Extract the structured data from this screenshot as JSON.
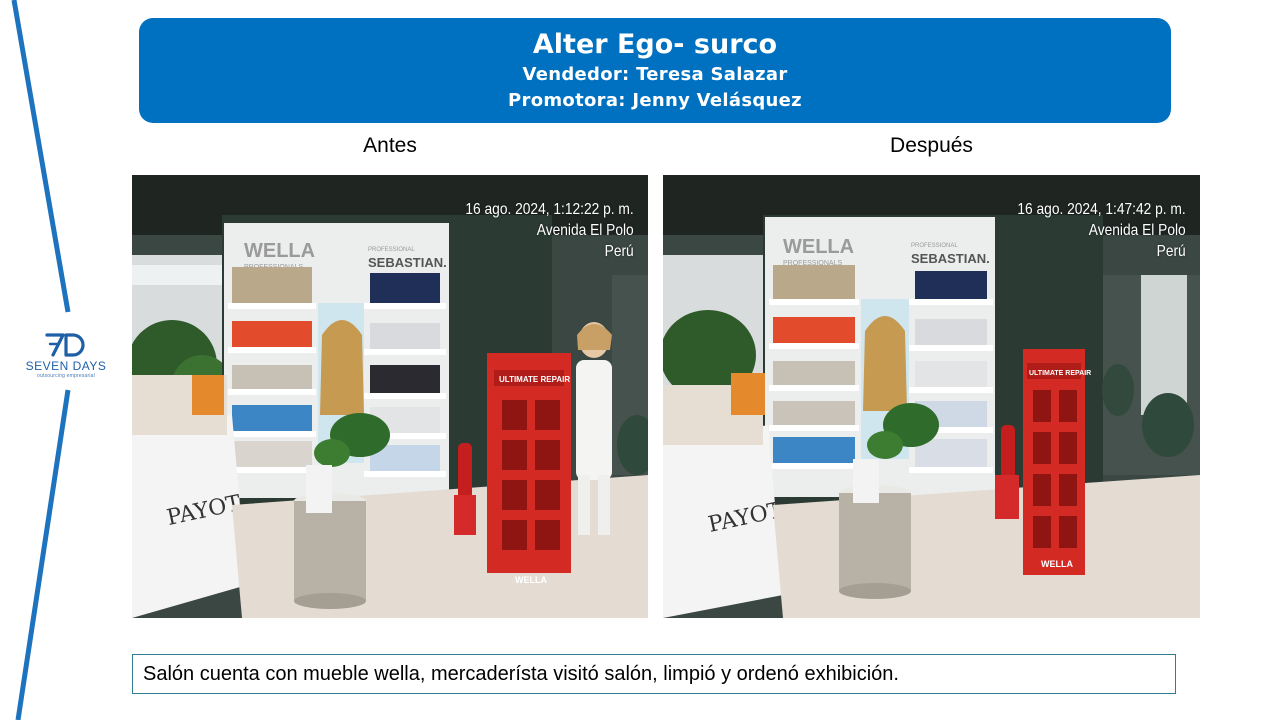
{
  "header": {
    "title": "Alter Ego- surco",
    "vendor_line": "Vendedor: Teresa Salazar",
    "promoter_line": "Promotora: Jenny Velásquez"
  },
  "logo": {
    "name": "SEVEN DAYS",
    "tagline": "outsourcing empresarial"
  },
  "photos": {
    "before": {
      "caption": "Antes",
      "stamp_date": "16 ago. 2024, 1:12:22 p. m.",
      "stamp_place": "Avenida El Polo",
      "stamp_country": "Perú"
    },
    "after": {
      "caption": "Después",
      "stamp_date": "16 ago. 2024, 1:47:42 p. m.",
      "stamp_place": "Avenida El Polo",
      "stamp_country": "Perú"
    }
  },
  "store_signage": {
    "brand_left": "WELLA",
    "brand_left_sub": "PROFESSIONALS",
    "brand_right": "SEBASTIAN.",
    "brand_right_sub": "PROFESSIONAL",
    "counter_brand": "PAYOT",
    "stand_title": "ULTIMATE REPAIR",
    "stand_logo": "WELLA"
  },
  "note": {
    "text": "Salón cuenta con mueble wella, mercaderísta visitó salón, limpió y ordenó exhibición."
  },
  "colors": {
    "header_bg": "#0070c0",
    "accent_line": "#1e73be",
    "note_border": "#2e7d92"
  }
}
